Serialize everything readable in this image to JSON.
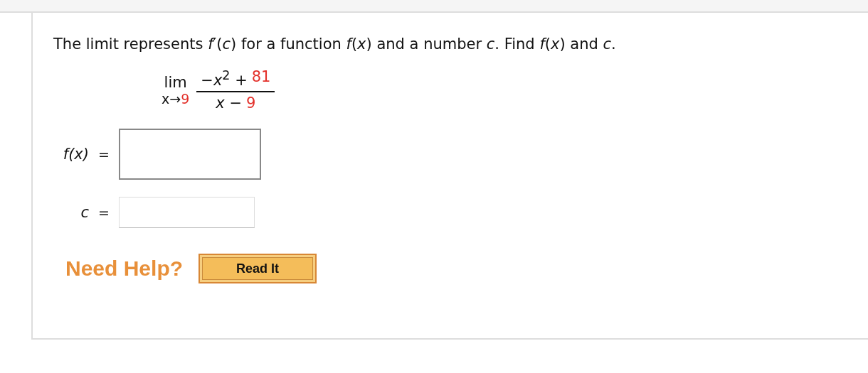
{
  "prompt": "The limit represents *f*′(*c*) for a function *f*(*x*) and a number *c*. Find *f*(*x*) and *c*.",
  "limit": {
    "word": "lim",
    "approach": [
      {
        "text": "x→",
        "highlighted": false
      },
      {
        "text": "9",
        "highlighted": true
      }
    ],
    "numerator": [
      {
        "text": "−*x*$^{2}$ +",
        "highlighted": false
      },
      {
        "text": "81",
        "highlighted": true
      }
    ],
    "denominator": [
      {
        "text": "*x* −",
        "highlighted": false
      },
      {
        "text": "9",
        "highlighted": true
      }
    ]
  },
  "answers": [
    {
      "label": "f(x)",
      "equals": "=",
      "kind": "large"
    },
    {
      "label": "c",
      "equals": "=",
      "kind": "small"
    }
  ],
  "help": {
    "label": "Need Help?",
    "button": "Read It"
  }
}
